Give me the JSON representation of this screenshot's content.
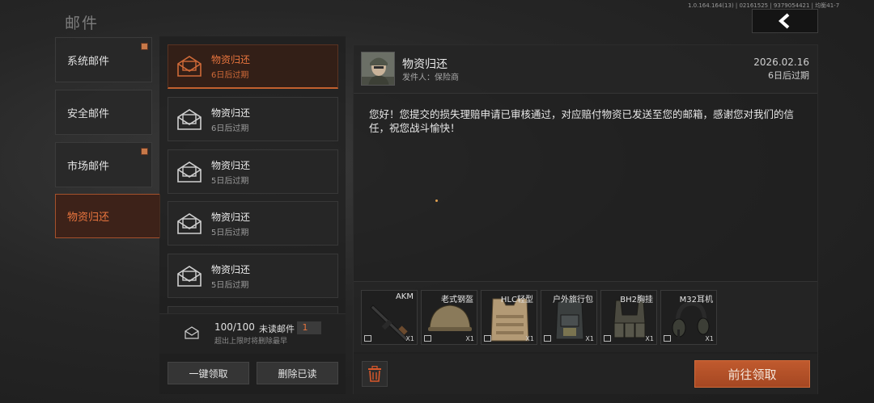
{
  "header": {
    "version": "1.0.164.164(13) | 02161525 | 9379054421 | 均衡41-7",
    "title": "邮件"
  },
  "categories": [
    {
      "label": "系统邮件",
      "has_dot": true
    },
    {
      "label": "安全邮件",
      "has_dot": false
    },
    {
      "label": "市场邮件",
      "has_dot": true
    },
    {
      "label": "物资归还",
      "has_dot": false,
      "active": true
    }
  ],
  "mail_list": [
    {
      "title": "物资归还",
      "expire": "6日后过期",
      "active": true
    },
    {
      "title": "物资归还",
      "expire": "6日后过期"
    },
    {
      "title": "物资归还",
      "expire": "5日后过期"
    },
    {
      "title": "物资归还",
      "expire": "5日后过期"
    },
    {
      "title": "物资归还",
      "expire": "5日后过期"
    }
  ],
  "list_footer": {
    "count": "100/100",
    "unread_label": "未读邮件",
    "unread_count": "1",
    "limit_note": "超出上限时将删除最早",
    "claim_all": "一键领取",
    "delete_read": "删除已读"
  },
  "detail": {
    "title": "物资归还",
    "sender": "发件人：保险商",
    "date": "2026.02.16",
    "expire": "6日后过期",
    "body": "您好！您提交的损失理赔申请已审核通过，对应赔付物资已发送至您的邮箱，感谢您对我们的信任，祝您战斗愉快！",
    "claim_button": "前往领取"
  },
  "attachments": [
    {
      "name": "AKM",
      "qty": "X1"
    },
    {
      "name": "老式钢盔",
      "qty": "X1"
    },
    {
      "name": "HLC轻型",
      "qty": "X1"
    },
    {
      "name": "户外旅行包",
      "qty": "X1"
    },
    {
      "name": "BH2胸挂",
      "qty": "X1"
    },
    {
      "name": "M32耳机",
      "qty": "X1"
    }
  ],
  "colors": {
    "accent": "#e9753e",
    "accent_button": "#b2502a",
    "background": "#262626"
  },
  "icons": {
    "back": "chevron-left-icon",
    "mail": "envelope-icon",
    "trash": "trash-icon",
    "box": "box-icon"
  }
}
